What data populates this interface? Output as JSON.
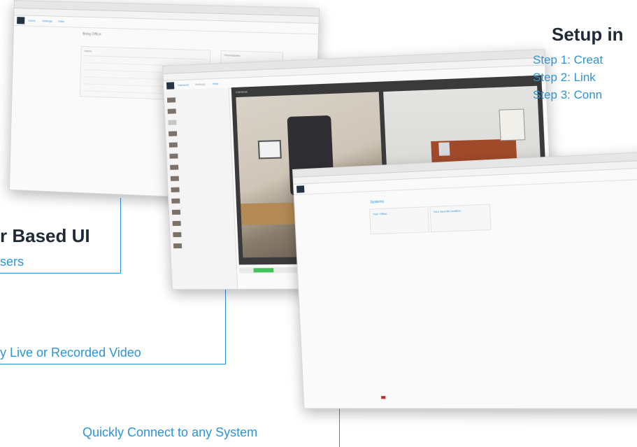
{
  "left_callout": {
    "heading": "r Based UI",
    "sub": "sers"
  },
  "middle_callout": {
    "text": "y Live or Recorded Video"
  },
  "bottom_callout": {
    "text": "Quickly Connect to any System"
  },
  "right_callout": {
    "heading": "Setup in",
    "steps": [
      "Step 1: Creat",
      "Step 2: Link",
      "Step 3: Conn"
    ]
  },
  "screen_back": {
    "title": "Bring Office",
    "tabs": [
      "Users",
      "Settings",
      "Files"
    ],
    "section_label": "Users",
    "right_panel_title": "Permissions"
  },
  "screen_mid": {
    "tabs": [
      "Cameras",
      "Settings",
      "Help"
    ],
    "view_label": "Cameras"
  },
  "screen_front": {
    "section_label": "Systems",
    "card_left_title": "Your Office",
    "card_right_title": "Your favorite location"
  },
  "colors": {
    "accent": "#2a94d6",
    "heading": "#1f2a36",
    "dark": "#243444"
  }
}
